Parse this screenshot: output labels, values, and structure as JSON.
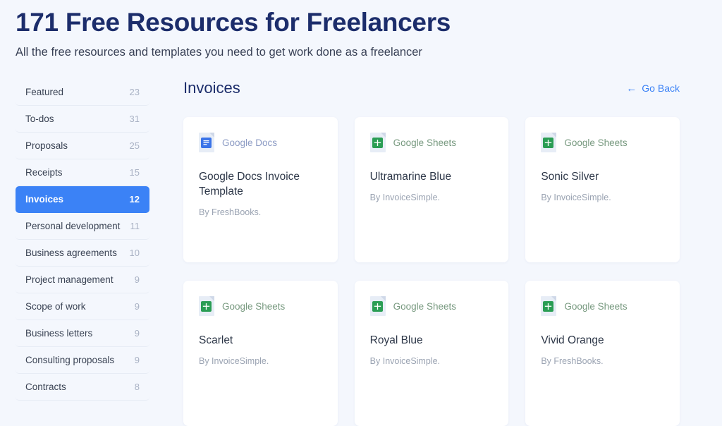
{
  "header": {
    "title": "171 Free Resources for Freelancers",
    "subtitle": "All the free resources and templates you need to get work done as a freelancer"
  },
  "sidebar": {
    "items": [
      {
        "label": "Featured",
        "count": "23",
        "active": false
      },
      {
        "label": "To-dos",
        "count": "31",
        "active": false
      },
      {
        "label": "Proposals",
        "count": "25",
        "active": false
      },
      {
        "label": "Receipts",
        "count": "15",
        "active": false
      },
      {
        "label": "Invoices",
        "count": "12",
        "active": true
      },
      {
        "label": "Personal development",
        "count": "11",
        "active": false
      },
      {
        "label": "Business agreements",
        "count": "10",
        "active": false
      },
      {
        "label": "Project management",
        "count": "9",
        "active": false
      },
      {
        "label": "Scope of work",
        "count": "9",
        "active": false
      },
      {
        "label": "Business letters",
        "count": "9",
        "active": false
      },
      {
        "label": "Consulting proposals",
        "count": "9",
        "active": false
      },
      {
        "label": "Contracts",
        "count": "8",
        "active": false
      }
    ]
  },
  "content": {
    "section_title": "Invoices",
    "go_back_label": "Go Back",
    "go_back_icon": "arrow-left-icon",
    "cards": [
      {
        "source": "Google Docs",
        "source_type": "docs",
        "icon": "google-docs-icon",
        "title": "Google Docs Invoice Template",
        "by": "By FreshBooks."
      },
      {
        "source": "Google Sheets",
        "source_type": "sheets",
        "icon": "google-sheets-icon",
        "title": "Ultramarine Blue",
        "by": "By InvoiceSimple."
      },
      {
        "source": "Google Sheets",
        "source_type": "sheets",
        "icon": "google-sheets-icon",
        "title": "Sonic Silver",
        "by": "By InvoiceSimple."
      },
      {
        "source": "Google Sheets",
        "source_type": "sheets",
        "icon": "google-sheets-icon",
        "title": "Scarlet",
        "by": "By InvoiceSimple."
      },
      {
        "source": "Google Sheets",
        "source_type": "sheets",
        "icon": "google-sheets-icon",
        "title": "Royal Blue",
        "by": "By InvoiceSimple."
      },
      {
        "source": "Google Sheets",
        "source_type": "sheets",
        "icon": "google-sheets-icon",
        "title": "Vivid Orange",
        "by": "By FreshBooks."
      }
    ]
  },
  "colors": {
    "background": "#f4f7fd",
    "title": "#1c2d6b",
    "accent": "#3b82f6",
    "docs_blue": "#3b74e8",
    "sheets_green": "#2a9d54",
    "card_background": "#ffffff"
  }
}
